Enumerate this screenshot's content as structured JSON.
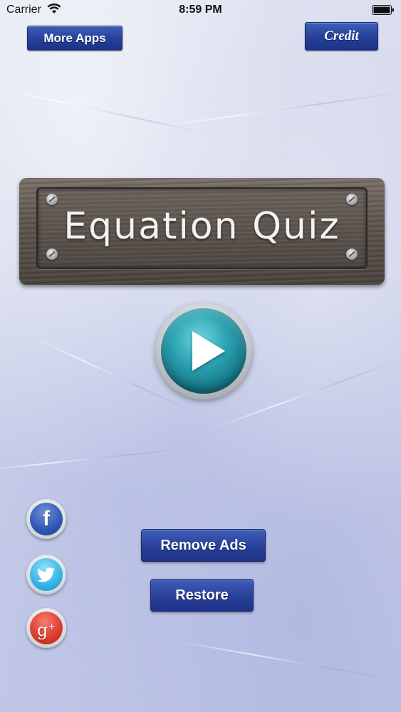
{
  "status_bar": {
    "carrier": "Carrier",
    "time": "8:59 PM"
  },
  "header": {
    "more_apps_label": "More Apps",
    "credit_label": "Credit"
  },
  "sign": {
    "title": "Equation Quiz"
  },
  "play": {
    "icon": "play-icon"
  },
  "social": {
    "facebook_glyph": "f",
    "googleplus_glyph": "g"
  },
  "actions": {
    "remove_ads_label": "Remove Ads",
    "restore_label": "Restore"
  },
  "colors": {
    "button_blue": "#283f98",
    "play_teal": "#2aa0b0",
    "facebook_blue": "#2f56b3",
    "twitter_blue": "#34b3e6",
    "googleplus_red": "#dc3a2c",
    "wood": "#5d544e"
  }
}
